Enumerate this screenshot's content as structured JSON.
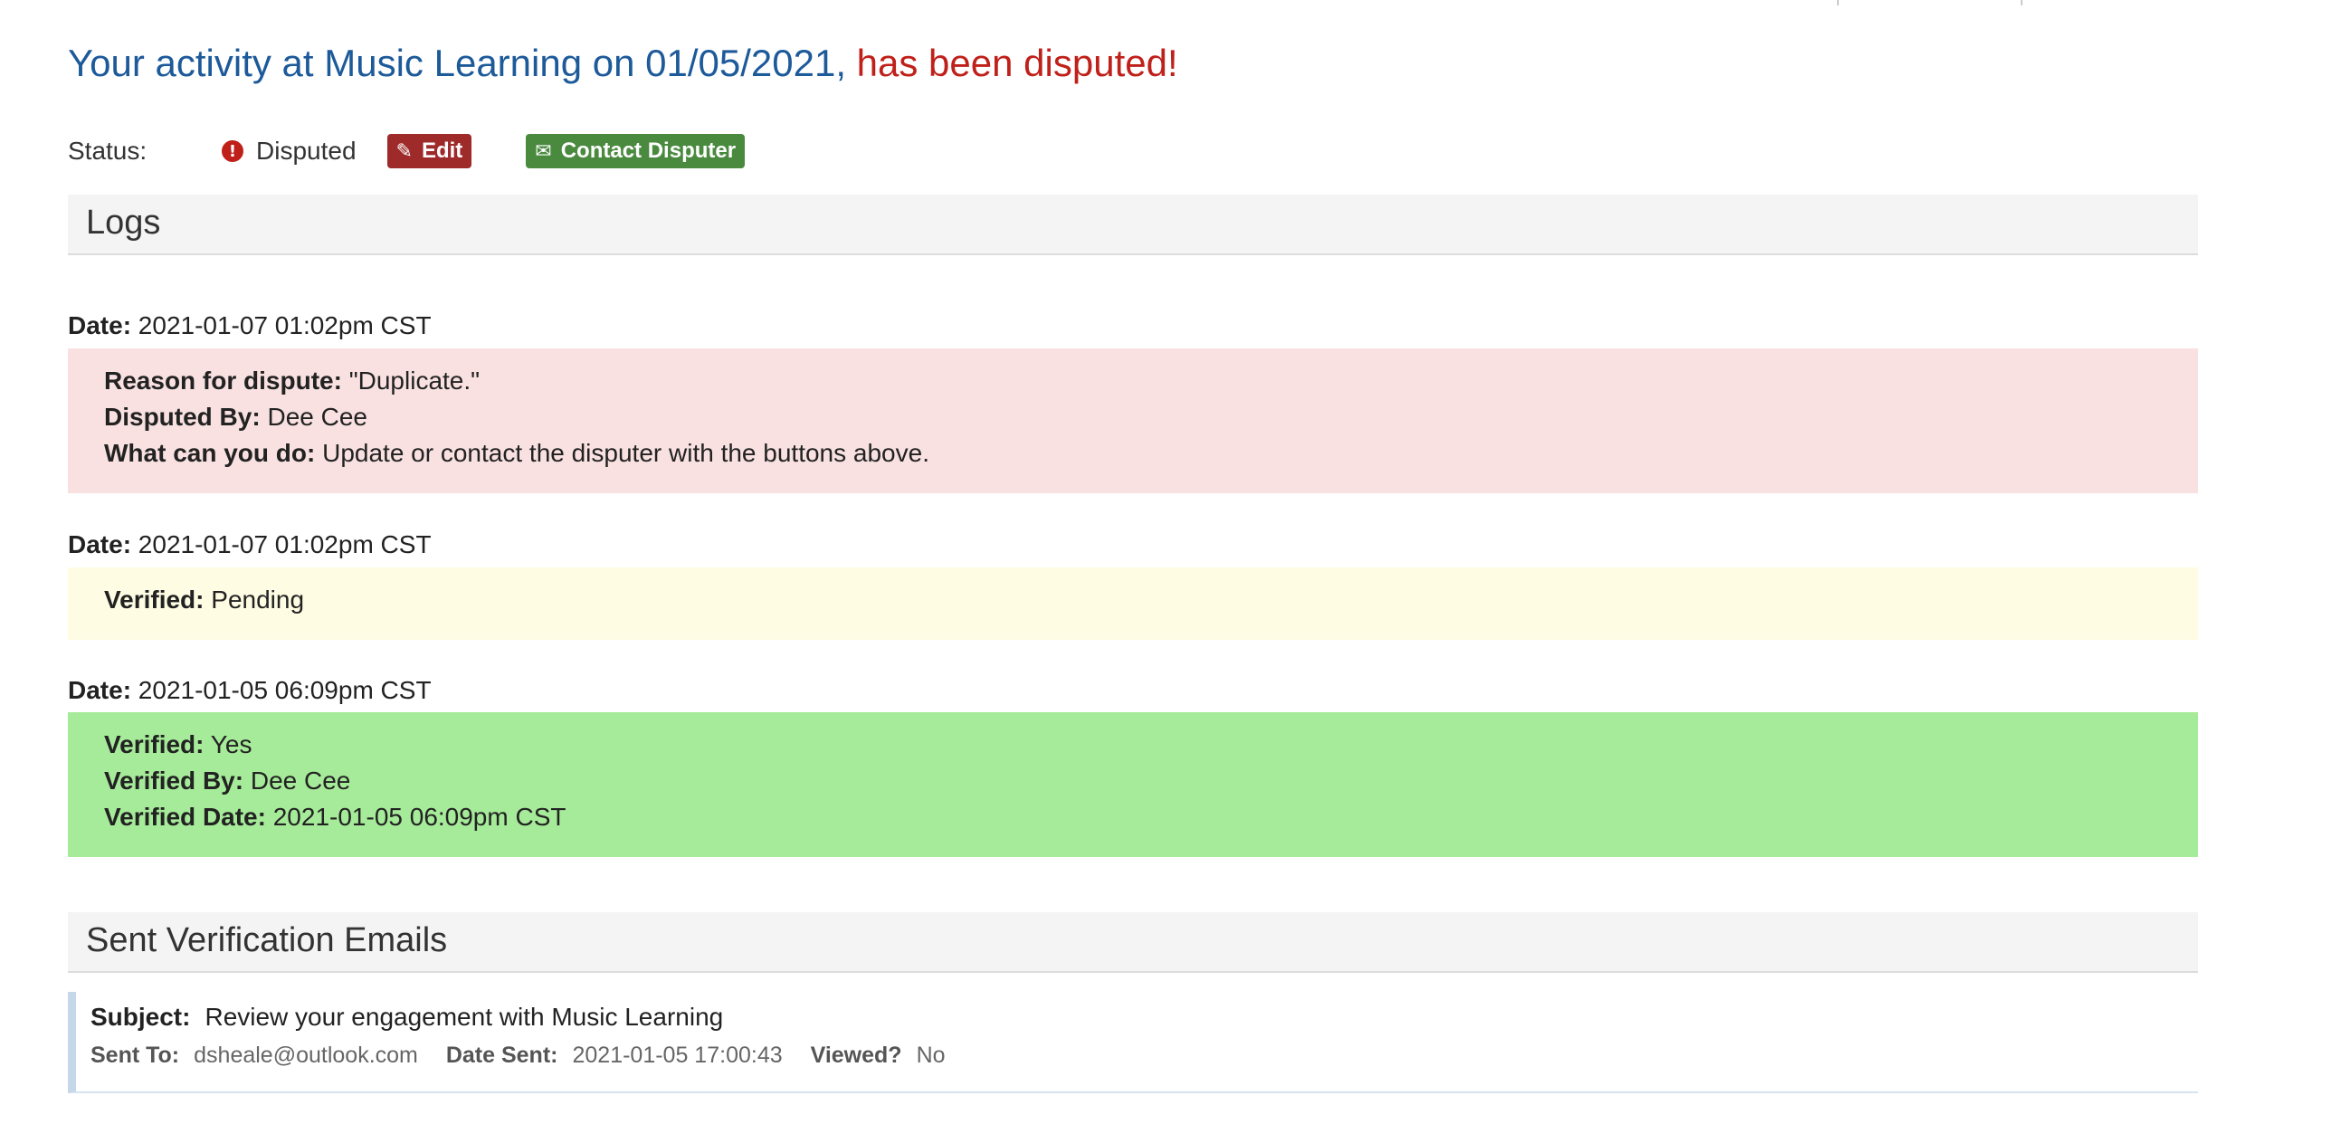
{
  "header": {
    "title_prefix": "Your activity at Music Learning on 01/05/2021,",
    "title_status": "has been disputed!"
  },
  "status": {
    "label": "Status:",
    "icon": "exclamation-circle-icon",
    "value": "Disputed",
    "edit_button": "Edit",
    "contact_button": "Contact Disputer"
  },
  "logs": {
    "heading": "Logs",
    "date_label": "Date:",
    "entries": [
      {
        "date": "2021-01-07 01:02pm CST",
        "lines": [
          {
            "label": "Reason for dispute:",
            "value": "\"Duplicate.\""
          },
          {
            "label": "Disputed By:",
            "value": "Dee Cee"
          },
          {
            "label": "What can you do:",
            "value": "Update or contact the disputer with the buttons above."
          }
        ]
      },
      {
        "date": "2021-01-07 01:02pm CST",
        "lines": [
          {
            "label": "Verified:",
            "value": "Pending"
          }
        ]
      },
      {
        "date": "2021-01-05 06:09pm CST",
        "lines": [
          {
            "label": "Verified:",
            "value": "Yes"
          },
          {
            "label": "Verified By:",
            "value": "Dee Cee"
          },
          {
            "label": "Verified Date:",
            "value": "2021-01-05 06:09pm CST"
          }
        ]
      }
    ]
  },
  "emails": {
    "heading": "Sent Verification Emails",
    "items": [
      {
        "subject_label": "Subject:",
        "subject": "Review your engagement with Music Learning",
        "sent_to_label": "Sent To:",
        "sent_to": "dsheale@outlook.com",
        "date_sent_label": "Date Sent:",
        "date_sent": "2021-01-05 17:00:43",
        "viewed_label": "Viewed?",
        "viewed": "No"
      }
    ]
  },
  "colors": {
    "title_blue": "#1d5a9a",
    "dispute_red": "#c0201a",
    "edit_button": "#9e2a2a",
    "contact_button": "#4a8a3f",
    "log_red": "#f9e1e1",
    "log_yellow": "#fefce2",
    "log_green": "#a6eb99"
  }
}
